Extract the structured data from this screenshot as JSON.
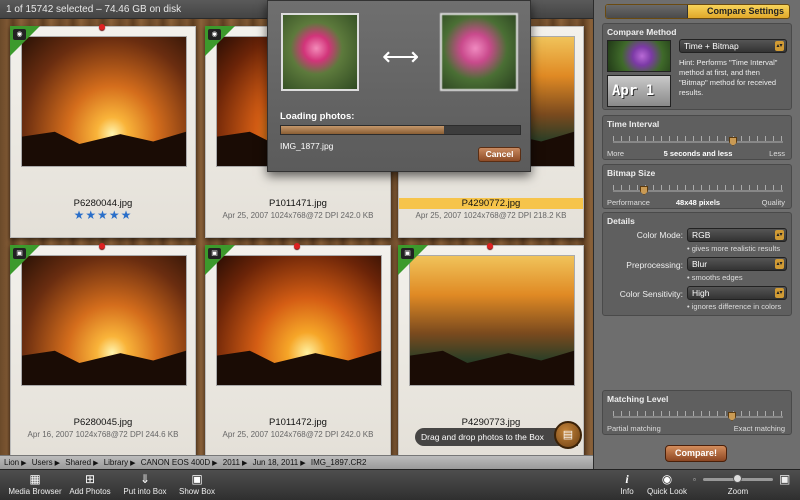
{
  "status_text": "1 of 15742 selected – 74.46 GB on disk",
  "loader": {
    "label": "Loading photos:",
    "progress": 0.68,
    "file": "IMG_1877.jpg",
    "cancel": "Cancel"
  },
  "photos": [
    {
      "name": "P6280044.jpg",
      "meta": "",
      "stars": "★★★★★",
      "selected": false
    },
    {
      "name": "P1011471.jpg",
      "meta": "Apr 25, 2007   1024x768@72 DPI   242.0 KB",
      "stars": "",
      "selected": false
    },
    {
      "name": "P4290772.jpg",
      "meta": "Apr 25, 2007   1024x768@72 DPI   218.2 KB",
      "stars": "",
      "selected": true
    },
    {
      "name": "P6280045.jpg",
      "meta": "Apr 16, 2007   1024x768@72 DPI   244.6 KB",
      "stars": "",
      "selected": false
    },
    {
      "name": "P1011472.jpg",
      "meta": "Apr 25, 2007   1024x768@72 DPI   242.0 KB",
      "stars": "",
      "selected": false
    },
    {
      "name": "P4290773.jpg",
      "meta": "",
      "stars": "",
      "selected": false
    }
  ],
  "drag_hint": "Drag and drop photos to the Box",
  "path": [
    "Lion",
    "Users",
    "Shared",
    "Library",
    "CANON EOS 400D",
    "2011",
    "Jun 18, 2011",
    "IMG_1897.CR2"
  ],
  "toolbar": {
    "media_browser": "Media Browser",
    "add_photos": "Add Photos",
    "put_into_box": "Put into Box",
    "show_box": "Show Box",
    "info": "Info",
    "quick_look": "Quick Look",
    "zoom": "Zoom"
  },
  "panel": {
    "tab": "Compare Settings",
    "compare_method": {
      "title": "Compare Method",
      "value": "Time + Bitmap",
      "thumb_text": "Apr 1",
      "hint": "Hint: Performs \"Time Interval\" method at first, and then \"Bitmap\" method for received results."
    },
    "time_interval": {
      "title": "Time Interval",
      "more": "More",
      "value": "5 seconds and less",
      "less": "Less"
    },
    "bitmap_size": {
      "title": "Bitmap Size",
      "performance": "Performance",
      "value": "48x48 pixels",
      "quality": "Quality"
    },
    "details": {
      "title": "Details",
      "color_mode_label": "Color Mode:",
      "color_mode": "RGB",
      "color_mode_hint": "• gives more realistic results",
      "preprocessing_label": "Preprocessing:",
      "preprocessing": "Blur",
      "preprocessing_hint": "• smooths edges",
      "sensitivity_label": "Color Sensitivity:",
      "sensitivity": "High",
      "sensitivity_hint": "• ignores difference in colors"
    },
    "matching": {
      "title": "Matching Level",
      "partial": "Partial matching",
      "exact": "Exact matching"
    },
    "compare_button": "Compare!"
  },
  "colors": {
    "accent_gold": "#f6c44a",
    "button_copper": "#8d4722",
    "corner_green": "#3c9a2c"
  }
}
